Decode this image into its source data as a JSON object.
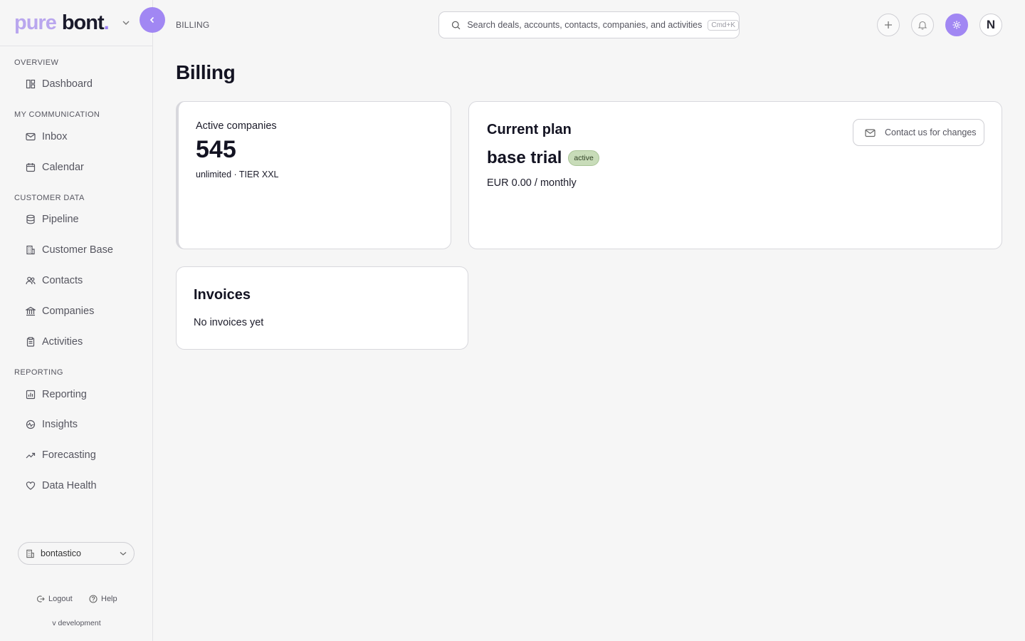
{
  "brand": {
    "word1": "pure",
    "word2": "bont",
    "dot": "."
  },
  "breadcrumb": "BILLING",
  "search": {
    "placeholder": "Search deals, accounts, contacts, companies, and activities",
    "shortcut": "Cmd+K"
  },
  "topbar": {
    "avatar_initial": "N"
  },
  "sidebar": {
    "sections": [
      {
        "label": "OVERVIEW"
      },
      {
        "label": "MY COMMUNICATION"
      },
      {
        "label": "CUSTOMER DATA"
      },
      {
        "label": "REPORTING"
      }
    ],
    "items": [
      {
        "label": "Dashboard",
        "icon": "dashboard-icon"
      },
      {
        "label": "Inbox",
        "icon": "mail-icon"
      },
      {
        "label": "Calendar",
        "icon": "calendar-icon"
      },
      {
        "label": "Pipeline",
        "icon": "database-icon"
      },
      {
        "label": "Customer Base",
        "icon": "building-icon"
      },
      {
        "label": "Contacts",
        "icon": "contacts-icon"
      },
      {
        "label": "Companies",
        "icon": "bank-icon"
      },
      {
        "label": "Activities",
        "icon": "clipboard-icon"
      },
      {
        "label": "Reporting",
        "icon": "bar-chart-icon"
      },
      {
        "label": "Insights",
        "icon": "activity-icon"
      },
      {
        "label": "Forecasting",
        "icon": "trending-up-icon"
      },
      {
        "label": "Data Health",
        "icon": "heart-icon"
      }
    ],
    "workspace": "bontastico",
    "logout": "Logout",
    "help": "Help",
    "version": "v development"
  },
  "page": {
    "title": "Billing",
    "active_companies": {
      "label": "Active companies",
      "value": "545",
      "sub": "unlimited · TIER XXL"
    },
    "plan": {
      "heading": "Current plan",
      "name": "base trial",
      "status": "active",
      "price": "EUR 0.00 / monthly",
      "contact_button": "Contact us for changes"
    },
    "invoices": {
      "heading": "Invoices",
      "empty": "No invoices yet"
    }
  },
  "colors": {
    "accent": "#a187f3",
    "brand_light": "#b9a6ee",
    "badge_bg": "#c8dcb9"
  }
}
